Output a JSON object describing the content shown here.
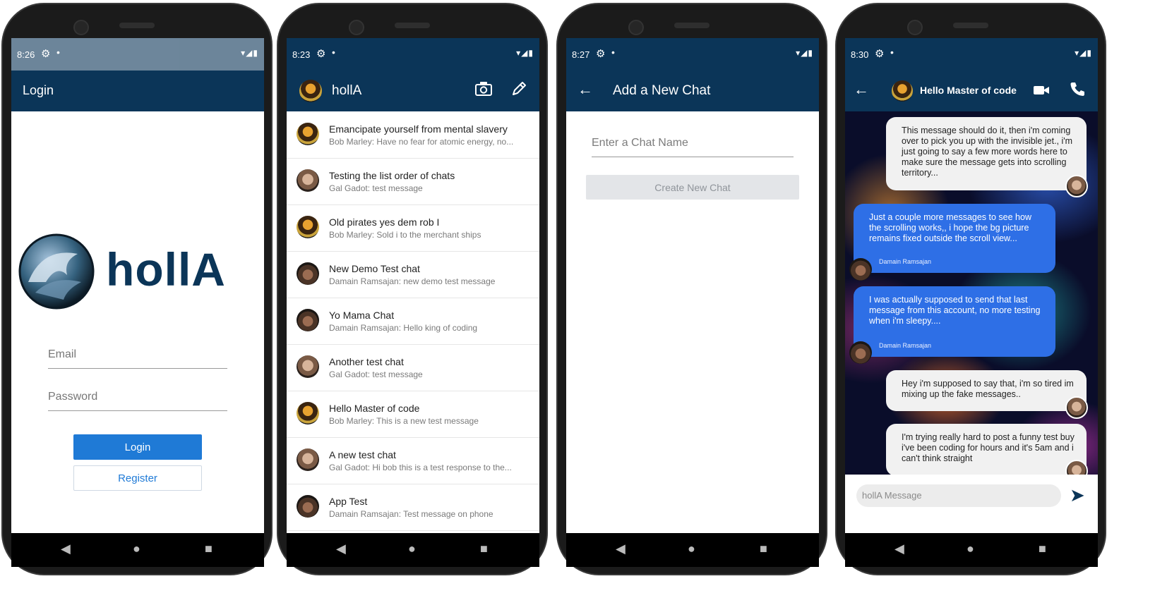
{
  "screens": {
    "login": {
      "status_time": "8:26",
      "title": "Login",
      "logo_text": "hollA",
      "email_placeholder": "Email",
      "password_placeholder": "Password",
      "login_label": "Login",
      "register_label": "Register"
    },
    "chats": {
      "status_time": "8:23",
      "title": "hollA",
      "items": [
        {
          "name": "Emancipate yourself from mental slavery",
          "preview": "Bob Marley: Have no fear for atomic energy, no...",
          "avatar": "bob"
        },
        {
          "name": "Testing the list order of chats",
          "preview": "Gal Gadot: test message",
          "avatar": "gal"
        },
        {
          "name": "Old pirates yes dem rob I",
          "preview": "Bob Marley: Sold i to the merchant ships",
          "avatar": "bob"
        },
        {
          "name": "New Demo Test chat",
          "preview": "Damain Ramsajan: new demo test message",
          "avatar": "dam"
        },
        {
          "name": "Yo Mama Chat",
          "preview": "Damain Ramsajan: Hello king of coding",
          "avatar": "dam"
        },
        {
          "name": "Another test chat",
          "preview": "Gal Gadot: test message",
          "avatar": "gal"
        },
        {
          "name": "Hello Master of code",
          "preview": "Bob Marley: This is a new test message",
          "avatar": "bob"
        },
        {
          "name": "A new test chat",
          "preview": "Gal Gadot: Hi bob this is a test response to the...",
          "avatar": "gal"
        },
        {
          "name": "App Test",
          "preview": "Damain Ramsajan: Test message on phone",
          "avatar": "dam"
        }
      ]
    },
    "new_chat": {
      "status_time": "8:27",
      "title": "Add a New Chat",
      "name_placeholder": "Enter a Chat Name",
      "create_label": "Create New Chat"
    },
    "conversation": {
      "status_time": "8:30",
      "title": "Hello Master of code",
      "messages": [
        {
          "direction": "in",
          "text": "This message should do it, then i'm coming over to pick you up with the invisible jet., i'm just going to say a few more words here to make sure the message gets into scrolling territory...",
          "sender": ""
        },
        {
          "direction": "out",
          "text": "Just a couple more messages to see how the scrolling works,, i hope the bg picture remains fixed outside the scroll view...",
          "sender": "Damain Ramsajan"
        },
        {
          "direction": "out",
          "text": "I was actually supposed to send that last message from this account, no more testing when i'm sleepy....",
          "sender": "Damain Ramsajan"
        },
        {
          "direction": "in",
          "text": "Hey i'm supposed to say that, i'm so tired im mixing up the fake messages..",
          "sender": ""
        },
        {
          "direction": "in",
          "text": "I'm trying really hard to post a funny test buy i've been coding for hours and it's 5am and i can't think straight",
          "sender": ""
        }
      ],
      "composer_placeholder": "hollA Message"
    }
  },
  "colors": {
    "primary": "#0b3558",
    "accent": "#1f7ad6",
    "bubble_out": "#2e6fe6",
    "bubble_in": "#f1f1f1"
  },
  "icons": {
    "status": [
      "gear-icon",
      "dot-icon",
      "wifi-icon",
      "signal-icon",
      "battery-icon"
    ],
    "nav": [
      "back-triangle-icon",
      "home-circle-icon",
      "recents-square-icon"
    ]
  }
}
